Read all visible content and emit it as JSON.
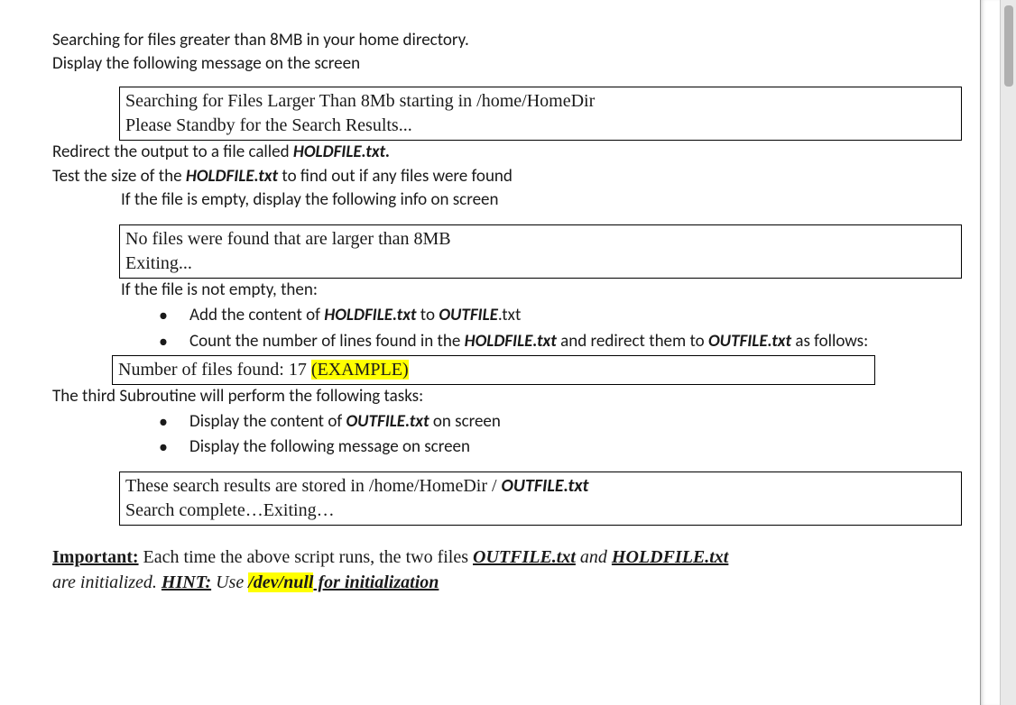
{
  "intro": {
    "line1": "Searching for files greater than 8MB in your home directory.",
    "line2": "Display the following message on the screen"
  },
  "box1": {
    "line1": "Searching for Files Larger Than 8Mb starting in /home/HomeDir",
    "line2": "Please Standby for the Search Results..."
  },
  "redirect": {
    "prefix": "Redirect the output to a file called ",
    "file": "HOLDFILE.txt."
  },
  "testsize": {
    "p1": "Test the size of the ",
    "file": "HOLDFILE.txt",
    "p2": " to find out if any files were found"
  },
  "ifempty": "If the file is empty, display the following info on screen",
  "box2": {
    "line1": "No files were found that are larger than 8MB",
    "line2": "Exiting..."
  },
  "ifnotempty": "If the file is not empty, then:",
  "bul1": {
    "p1": "Add the content of ",
    "f1": "HOLDFILE.txt",
    "p2": " to ",
    "f2a": "OUTFILE",
    "f2b": ".txt"
  },
  "bul2": {
    "p1": "Count the number of lines found in the ",
    "f1": "HOLDFILE.txt",
    "p2": " and redirect them to ",
    "f2": "OUTFILE.txt",
    "p3": " as follows:"
  },
  "box3": {
    "p1": "Number of files found: 17  ",
    "ex": "(EXAMPLE)"
  },
  "third": "The third Subroutine will perform the following tasks:",
  "bul3": {
    "p1": "Display the content of ",
    "f1": "OUTFILE.txt",
    "p2": " on screen"
  },
  "bul4": "Display the following message on screen",
  "box4": {
    "line1a": "These search results are stored in /home/HomeDir / ",
    "line1b": "OUTFILE.txt",
    "line2": "Search complete…Exiting…"
  },
  "important": {
    "label": "Important:",
    "p1": " Each time the above script runs, the two files ",
    "f1": "OUTFILE.txt",
    "p2": " and ",
    "f2": "HOLDFILE.txt",
    "p3": "are initialized. ",
    "hint_label": "HINT:",
    "p4": " Use ",
    "devnull": "/dev/null",
    "p5": " for initialization"
  }
}
